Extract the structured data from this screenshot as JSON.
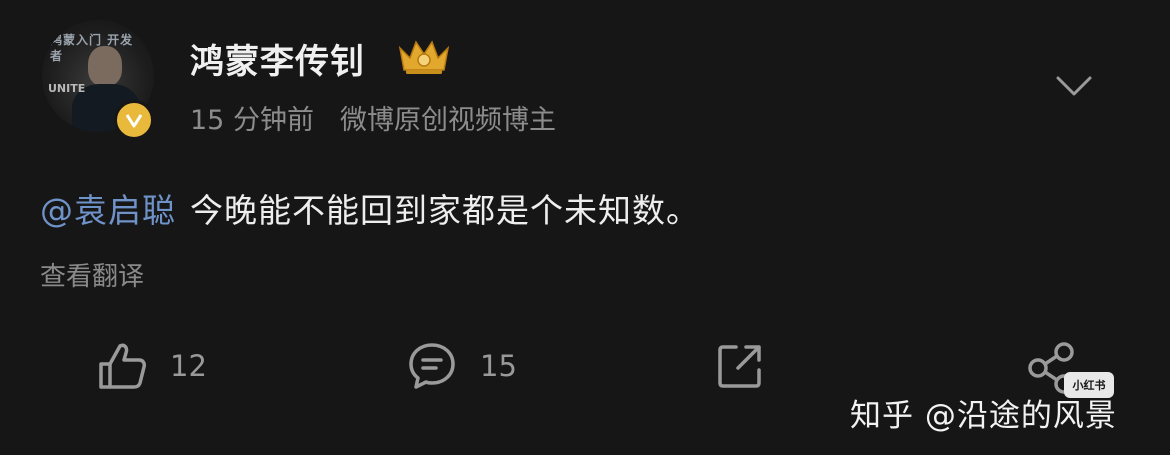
{
  "post": {
    "avatar": {
      "banner": "鸿蒙入门 开发者",
      "brand": "UNITE",
      "badge_icon": "verified-v-icon"
    },
    "username": "鸿蒙李传钊",
    "crown_icon": "gold-crown-badge-icon",
    "time": "15 分钟前",
    "source": "微博原创视频博主",
    "expand_icon": "chevron-down-icon",
    "mention": "@袁启聪",
    "text": "今晚能不能回到家都是个未知数。",
    "translate_label": "查看翻译",
    "actions": {
      "like_count": "12",
      "comment_count": "15",
      "like_icon": "thumbs-up-icon",
      "comment_icon": "comment-bubble-icon",
      "repost_icon": "share-external-icon",
      "share_icon": "share-nodes-icon"
    }
  },
  "watermark": {
    "text": "知乎 @沿途的风景",
    "logo": "小红书"
  },
  "colors": {
    "background": "#161616",
    "mention": "#6f93c9",
    "meta": "#8c8c8c",
    "badge": "#e9b93c"
  }
}
